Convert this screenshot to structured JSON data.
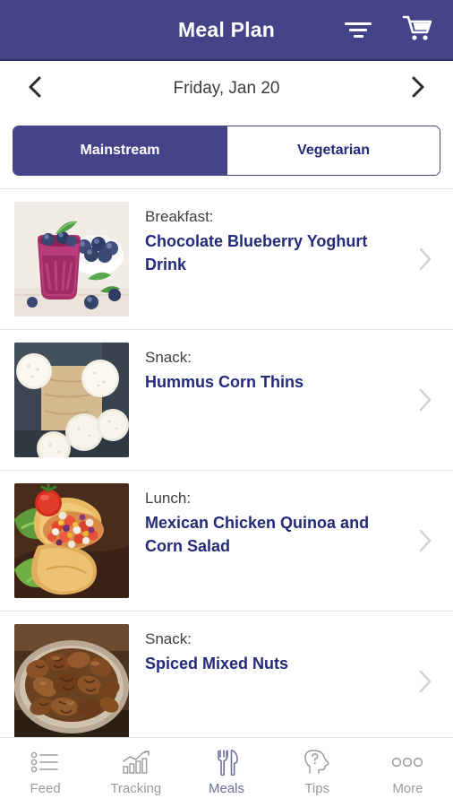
{
  "header": {
    "title": "Meal Plan",
    "filter_icon": "filter-icon",
    "cart_icon": "shopping-cart-icon",
    "background_color": "#454388"
  },
  "date_nav": {
    "prev_icon": "chevron-left-icon",
    "next_icon": "chevron-right-icon",
    "date": "Friday, Jan 20"
  },
  "diet_tabs": {
    "selected": "Mainstream",
    "options": [
      {
        "label": "Mainstream",
        "active": true
      },
      {
        "label": "Vegetarian",
        "active": false
      }
    ]
  },
  "meals": [
    {
      "type": "Breakfast:",
      "name": "Chocolate Blueberry Yoghurt Drink",
      "image": "blueberry-smoothie-photo",
      "chevron_icon": "chevron-right-icon"
    },
    {
      "type": "Snack:",
      "name": "Hummus Corn Thins",
      "image": "corn-thins-photo",
      "chevron_icon": "chevron-right-icon"
    },
    {
      "type": "Lunch:",
      "name": "Mexican Chicken Quinoa and Corn Salad",
      "image": "taco-salad-photo",
      "chevron_icon": "chevron-right-icon"
    },
    {
      "type": "Snack:",
      "name": "Spiced Mixed Nuts",
      "image": "mixed-nuts-photo",
      "chevron_icon": "chevron-right-icon"
    }
  ],
  "bottom_nav": {
    "active": "Meals",
    "items": [
      {
        "label": "Feed",
        "icon": "bulleted-list-icon",
        "active": false
      },
      {
        "label": "Tracking",
        "icon": "bar-chart-trend-icon",
        "active": false
      },
      {
        "label": "Meals",
        "icon": "fork-knife-icon",
        "active": true
      },
      {
        "label": "Tips",
        "icon": "head-question-icon",
        "active": false
      },
      {
        "label": "More",
        "icon": "three-dots-icon",
        "active": false
      }
    ],
    "active_color": "#6b6f9e",
    "inactive_color": "#9a9a9f"
  }
}
